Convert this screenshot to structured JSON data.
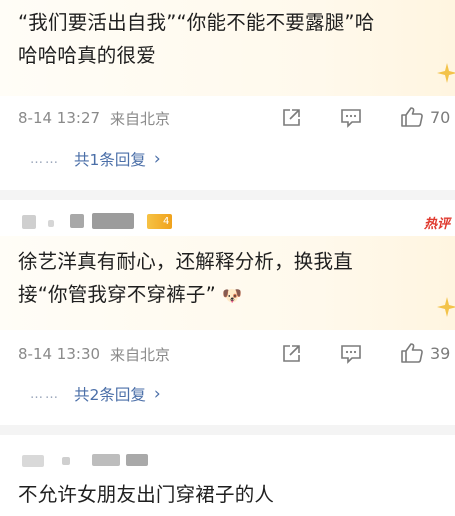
{
  "comments": [
    {
      "text_line1": "“我们要活出自我”“你能不能不要露腿”哈",
      "text_line2": "哈哈哈真的很爱",
      "time": "8-14 13:27",
      "location": "来自北京",
      "like_count": "70",
      "reply_link": "共1条回复"
    },
    {
      "level_badge": "4",
      "hot_tag": "热评",
      "text_line1": "徐艺洋真有耐心，还解释分析，换我直",
      "text_line2": "接“你管我穿不穿裤子”",
      "emoji": "🐶",
      "time": "8-14 13:30",
      "location": "来自北京",
      "like_count": "39",
      "reply_link": "共2条回复"
    },
    {
      "text_line1": "不允许女朋友出门穿裙子的人"
    }
  ],
  "reply_dots": "……",
  "chevron": "›",
  "icons": {
    "share": "share-icon",
    "comment": "comment-icon",
    "like": "thumbs-up-icon"
  },
  "colors": {
    "link": "#4b6fa8",
    "meta": "#8a8a8a",
    "hot": "#e03a2f",
    "badge": "#f0a21c"
  }
}
